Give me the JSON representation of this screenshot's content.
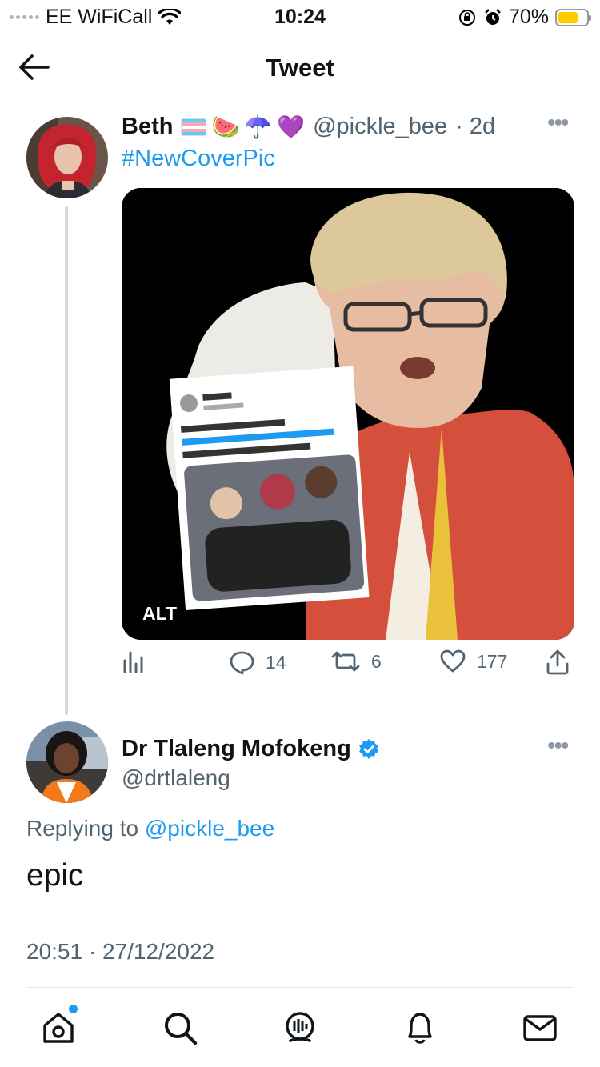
{
  "status_bar": {
    "carrier": "EE WiFiCall",
    "time": "10:24",
    "battery": "70%",
    "battery_level": 0.7
  },
  "nav": {
    "title": "Tweet"
  },
  "tweet": {
    "name": "Beth",
    "emojis": [
      "transgender-flag",
      "🍉",
      "☂️",
      "💜"
    ],
    "handle": "@pickle_bee",
    "age": "· 2d",
    "hashtag": "#NewCoverPic",
    "alt_badge": "ALT",
    "image_description_icon": "photo-collage",
    "metrics": {
      "replies": "14",
      "retweets": "6",
      "likes": "177"
    }
  },
  "reply": {
    "name": "Dr Tlaleng Mofokeng",
    "handle": "@drtlaleng",
    "replying_prefix": "Replying to",
    "replying_to": "@pickle_bee",
    "text": "epic",
    "timestamp": "20:51 · 27/12/2022"
  },
  "tabs": [
    "home-icon",
    "search-icon",
    "spaces-icon",
    "notifications-icon",
    "messages-icon"
  ],
  "colors": {
    "accent": "#1d9bf0",
    "muted": "#536471",
    "battery": "#ffcc00",
    "verified": "#1d9bf0"
  }
}
